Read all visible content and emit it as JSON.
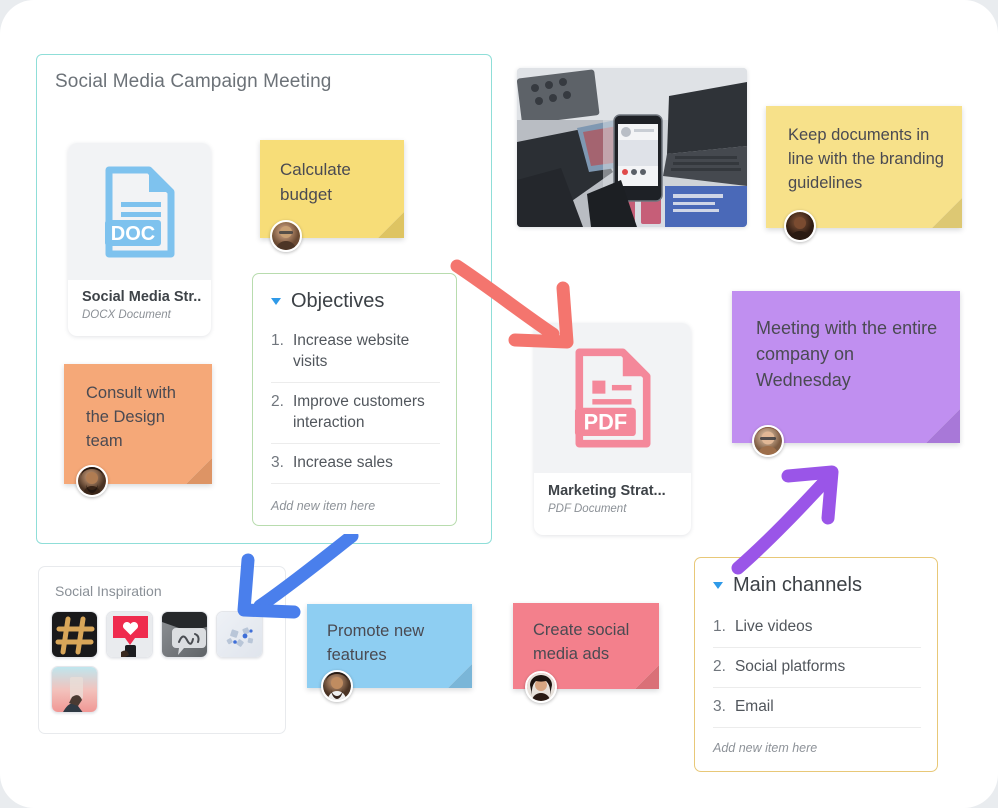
{
  "board": {
    "background": "#ffffff",
    "accent_teal": "#8fded8"
  },
  "frame": {
    "title": "Social Media Campaign Meeting",
    "border_color": "#8fded8"
  },
  "panel": {
    "title": "Social Inspiration",
    "border_color": "#e8eaed",
    "thumbnails": [
      {
        "name": "hashtag-thumbnail",
        "alt": "Hashtag made of cookies on black background"
      },
      {
        "name": "heart-like-thumbnail",
        "alt": "Red heart like icon above a phone"
      },
      {
        "name": "hello-speech-thumbnail",
        "alt": "Hello speech bubble drawing"
      },
      {
        "name": "network-thumbnail",
        "alt": "Paper network scatter on white"
      },
      {
        "name": "phone-sunset-thumbnail",
        "alt": "Hand holding phone at sunset"
      }
    ]
  },
  "files": [
    {
      "name": "Social Media Str...",
      "type": "DOCX Document",
      "badge": "DOC",
      "color": "#7ec2ee",
      "icon": "doc-file-icon"
    },
    {
      "name": "Marketing Strat...",
      "type": "PDF Document",
      "badge": "PDF",
      "color": "#f4889a",
      "icon": "pdf-file-icon"
    }
  ],
  "lists": [
    {
      "id": "objectives",
      "title": "Objectives",
      "border_color": "#b8dcae",
      "caret_color": "#2f9ae8",
      "items": [
        {
          "num": "1.",
          "text": "Increase website visits"
        },
        {
          "num": "2.",
          "text": "Improve customers interaction"
        },
        {
          "num": "3.",
          "text": "Increase sales"
        }
      ],
      "add_new_label": "Add new item here"
    },
    {
      "id": "main-channels",
      "title": "Main channels",
      "border_color": "#e8c878",
      "caret_color": "#2f9ae8",
      "items": [
        {
          "num": "1.",
          "text": "Live videos"
        },
        {
          "num": "2.",
          "text": "Social platforms"
        },
        {
          "num": "3.",
          "text": "Email"
        }
      ],
      "add_new_label": "Add new item here"
    }
  ],
  "stickies": [
    {
      "id": "calculate-budget",
      "text": "Calculate\nbudget",
      "color": "#f7dd78",
      "fold_color": "#dec462",
      "avatar": "avatar-bearded-man"
    },
    {
      "id": "keep-documents",
      "text": "Keep documents in line with the branding guidelines",
      "color": "#f7e18a",
      "fold_color": "#ddc873",
      "avatar": "avatar-smiling-woman"
    },
    {
      "id": "consult-design",
      "text": "Consult with the Design team",
      "color": "#f5a878",
      "fold_color": "#dd9465",
      "avatar": "avatar-man-beard-dark"
    },
    {
      "id": "meeting-wednesday",
      "text": "Meeting with the entire company on Wednesday",
      "color": "#c08ff0",
      "fold_color": "#a878d8",
      "avatar": "avatar-man-glasses"
    },
    {
      "id": "promote-features",
      "text": "Promote new features",
      "color": "#8ecef2",
      "fold_color": "#7ab6d8",
      "avatar": "avatar-man-beard"
    },
    {
      "id": "create-ads",
      "text": "Create social media ads",
      "color": "#f3808c",
      "fold_color": "#da7078",
      "avatar": "avatar-woman-dark-hair"
    }
  ],
  "photos": [
    {
      "id": "social-media-phone-photo",
      "alt": "Hand holding smartphone over magazines and keyboard"
    }
  ],
  "arrows": [
    {
      "id": "arrow-red",
      "color": "#f4756e",
      "direction": "down-right",
      "from": "objectives",
      "to": "pdf-file"
    },
    {
      "id": "arrow-blue",
      "color": "#4a7fec",
      "direction": "down-left",
      "from": "frame",
      "to": "social-inspiration"
    },
    {
      "id": "arrow-purple",
      "color": "#9a55e8",
      "direction": "up-right",
      "from": "main-channels",
      "to": "meeting-wednesday"
    }
  ]
}
